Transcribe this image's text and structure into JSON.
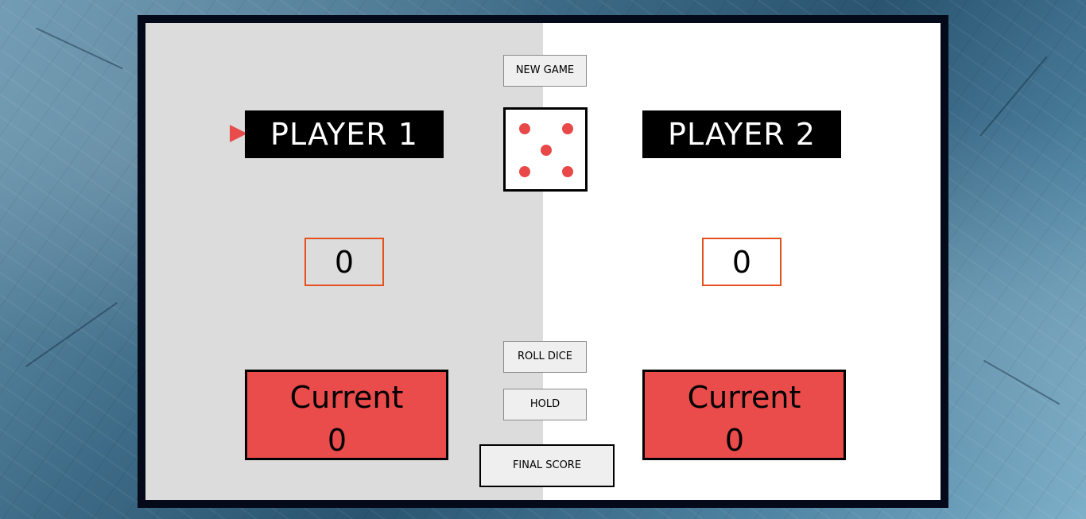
{
  "buttons": {
    "new_game": "NEW GAME",
    "roll_dice": "ROLL DICE",
    "hold": "HOLD",
    "final_score": "FINAL SCORE"
  },
  "players": [
    {
      "name": "PLAYER 1",
      "total_score": "0",
      "current_label": "Current",
      "current_score": "0",
      "active": true
    },
    {
      "name": "PLAYER 2",
      "total_score": "0",
      "current_label": "Current",
      "current_score": "0",
      "active": false
    }
  ],
  "dice": {
    "value": 5
  },
  "colors": {
    "accent_red": "#e84c4c",
    "score_border": "#e4501e",
    "board_border": "#050a1a",
    "left_panel": "#dcdcdc",
    "right_panel": "#ffffff"
  },
  "icons": {
    "active_player_marker": "triangle-right-icon"
  }
}
